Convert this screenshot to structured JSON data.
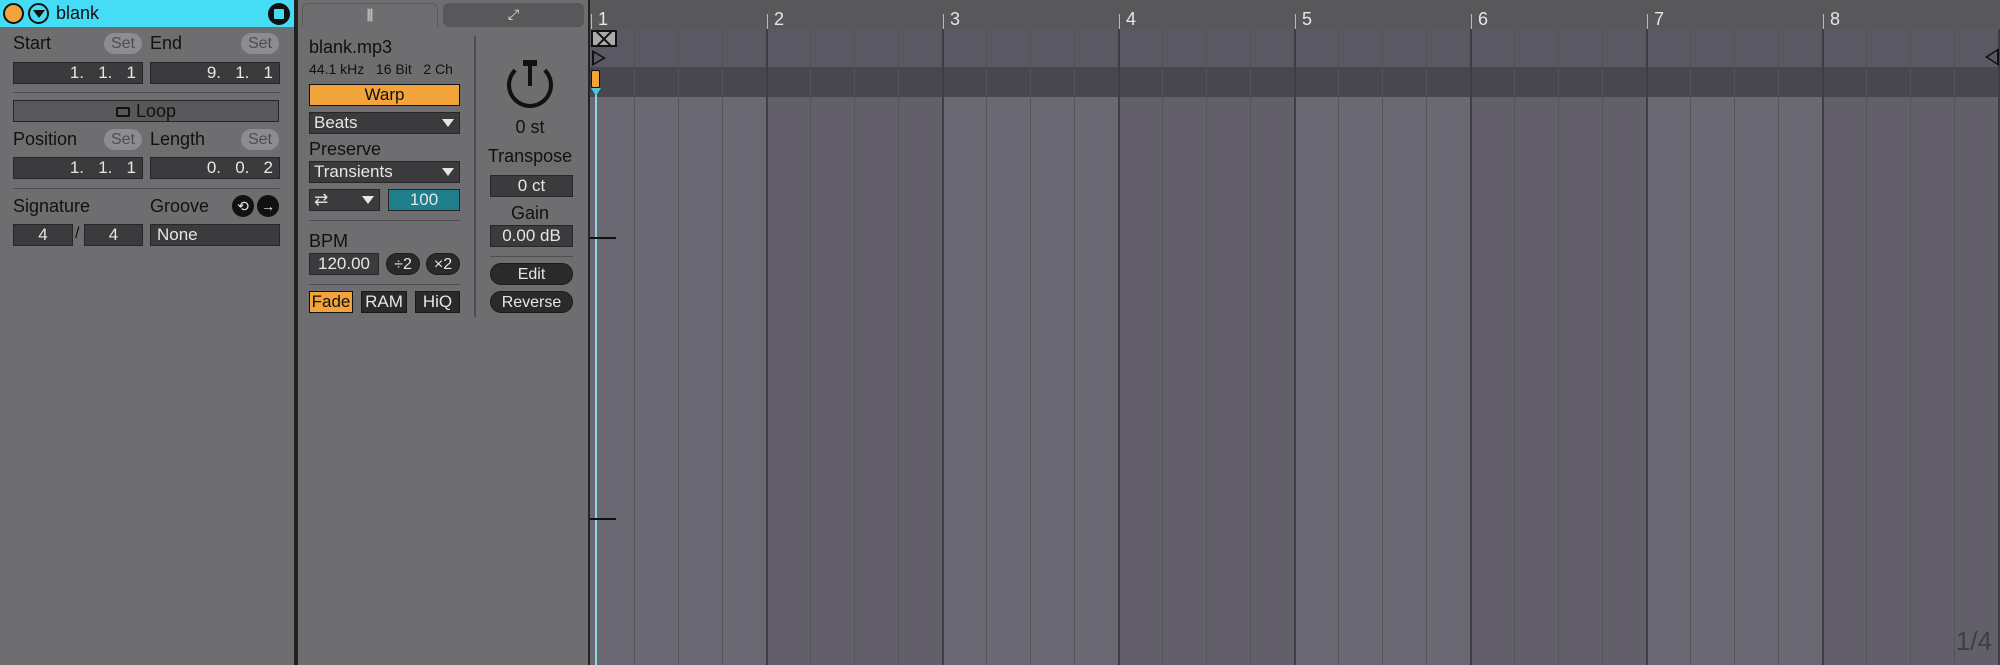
{
  "clip": {
    "name": "blank",
    "start_label": "Start",
    "end_label": "End",
    "set_label": "Set",
    "start_value": "1.   1.   1",
    "end_value": "9.   1.   1",
    "loop_label": "Loop",
    "position_label": "Position",
    "length_label": "Length",
    "position_value": "1.   1.   1",
    "length_value": "0.   0.   2",
    "signature_label": "Signature",
    "groove_label": "Groove",
    "sig_numerator": "4",
    "sig_slash": "/",
    "sig_denominator": "4",
    "groove_value": "None"
  },
  "sample": {
    "filename": "blank.mp3",
    "info": "44.1 kHz   16 Bit   2 Ch",
    "warp_label": "Warp",
    "warp_mode": "Beats",
    "preserve_label": "Preserve",
    "preserve_value": "Transients",
    "loop_mode_glyph": "⇄",
    "envelope_value": "100",
    "bpm_label": "BPM",
    "bpm_value": "120.00",
    "half_label": "÷2",
    "double_label": "×2",
    "fade_label": "Fade",
    "ram_label": "RAM",
    "hiq_label": "HiQ",
    "transpose_value": "0 st",
    "transpose_label": "Transpose",
    "detune_value": "0 ct",
    "gain_label": "Gain",
    "gain_value": "0.00 dB",
    "edit_label": "Edit",
    "reverse_label": "Reverse"
  },
  "editor": {
    "bar_numbers": [
      "1",
      "2",
      "3",
      "4",
      "5",
      "6",
      "7",
      "8"
    ],
    "zoom": "1/4"
  },
  "colors": {
    "clip_header": "#46dcf5",
    "accent_orange": "#f2a33a",
    "envelope_teal": "#1e7e8c"
  }
}
